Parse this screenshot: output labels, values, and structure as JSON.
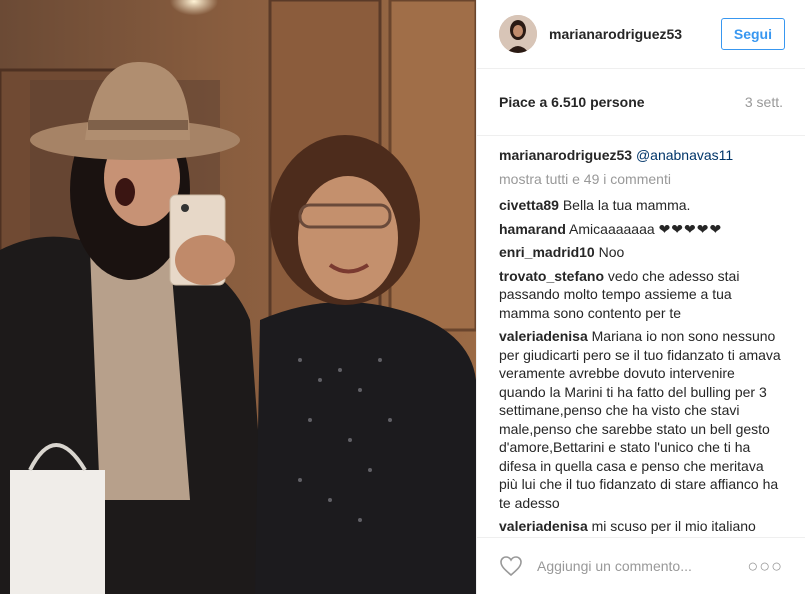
{
  "post": {
    "username": "marianarodriguez53",
    "follow_label": "Segui",
    "likes_text": "Piace a 6.510 persone",
    "time_ago": "3 sett."
  },
  "caption": {
    "user": "marianarodriguez53",
    "mention": "@anabnavas11"
  },
  "show_all": "mostra tutti e 49 i commenti",
  "comments": [
    {
      "user": "civetta89",
      "text": "Bella la tua mamma."
    },
    {
      "user": "hamarand",
      "text": "Amicaaaaaaa",
      "hearts": "❤❤❤❤❤"
    },
    {
      "user": "enri_madrid10",
      "text": "Noo"
    },
    {
      "user": "trovato_stefano",
      "text": "vedo che adesso stai passando molto tempo assieme a tua mamma sono contento per te"
    },
    {
      "user": "valeriadenisa",
      "text": "Mariana io non sono nessuno per giudicarti pero se il tuo fidanzato ti amava veramente avrebbe dovuto intervenire quando la Marini ti ha fatto del bulling per 3 settimane,penso che ha visto che stavi male,penso che sarebbe stato un bell gesto d'amore,Bettarini e stato l'unico che ti ha difesa in quella casa e penso che meritava più lui che il tuo fidanzato di stare affianco ha te adesso"
    },
    {
      "user": "valeriadenisa",
      "text": "mi scuso per il mio italiano"
    }
  ],
  "footer": {
    "placeholder": "Aggiungi un commento...",
    "more": "○○○"
  },
  "colors": {
    "accent": "#3897f0",
    "text": "#262626",
    "muted": "#999999",
    "border": "#efefef"
  }
}
